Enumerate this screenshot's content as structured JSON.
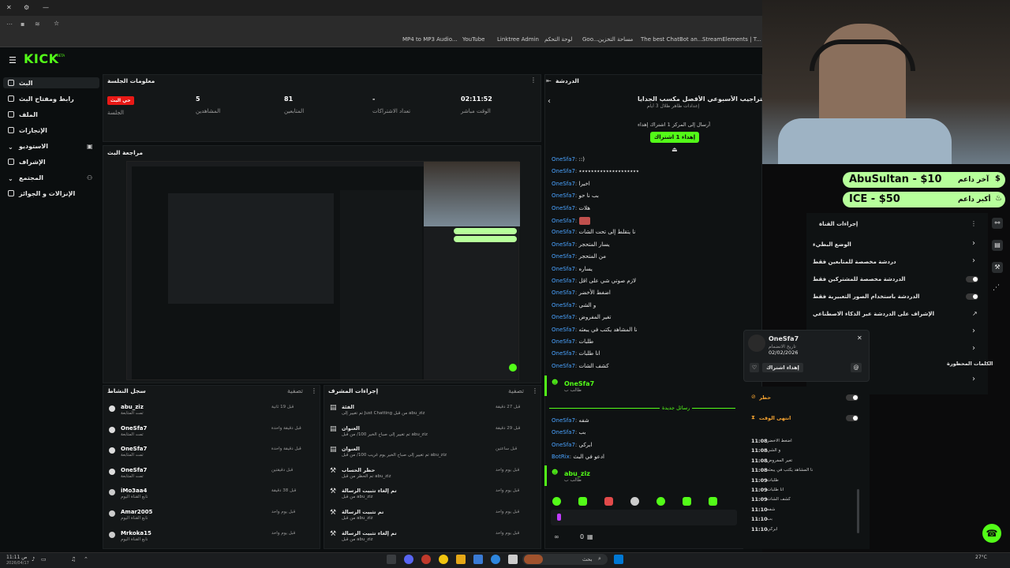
{
  "browser": {
    "bookmarks": [
      "MP4 to MP3 Audio...",
      "YouTube",
      "Linktree Admin",
      "لوحة التحكم",
      "Goo...",
      "مساحة التخزين",
      "The best ChatBot an...",
      "StreamElements | T..."
    ]
  },
  "brand": {
    "logo": "KICK",
    "beta": "BETA"
  },
  "sidebar": {
    "items": [
      {
        "label": "البث"
      },
      {
        "label": "رابط ومفتاح البث"
      },
      {
        "label": "الملف"
      },
      {
        "label": "الإنجازات"
      },
      {
        "label": "الاستوديو"
      },
      {
        "label": "الإشراف"
      },
      {
        "label": "المجتمع"
      },
      {
        "label": "الإنزالات و الجوائز"
      }
    ]
  },
  "session": {
    "title": "معلومات الجلسة",
    "live_badge": "حي البث",
    "session_label": "الجلسة",
    "stats": [
      {
        "value": "5",
        "label": "المشاهدين"
      },
      {
        "value": "81",
        "label": "المتابعين"
      },
      {
        "value": "-",
        "label": "تعداد الاشتراكات"
      },
      {
        "value": "02:11:52",
        "label": "الوقت مباشر"
      }
    ]
  },
  "preview": {
    "title": "مراجعة البث"
  },
  "activity": {
    "title": "سجل النشاط",
    "filter": "تصفية",
    "rows": [
      {
        "user": "abu_ziz",
        "action": "تمت المتابعة",
        "time": "قبل 19 ثانية"
      },
      {
        "user": "OneSfa7",
        "action": "تمت المتابعة",
        "time": "قبل دقيقة واحدة"
      },
      {
        "user": "OneSfa7",
        "action": "تمت المتابعة",
        "time": "قبل دقيقة واحدة"
      },
      {
        "user": "OneSfa7",
        "action": "تمت المتابعة",
        "time": "قبل دقيقتين"
      },
      {
        "user": "iMo3aa4",
        "action": "تابع القناة اليوم",
        "time": "قبل 38 دقيقة"
      },
      {
        "user": "Amar2005",
        "action": "تابع القناة اليوم",
        "time": "قبل يوم واحد"
      },
      {
        "user": "Mrkoka15",
        "action": "تابع القناة اليوم",
        "time": "قبل يوم واحد"
      }
    ]
  },
  "modlog": {
    "title": "إجراءات المشرف",
    "filter": "تصفية",
    "rows": [
      {
        "title": "الفئة",
        "detail": "تم تغيير إلى Just Chatting من قبل abu_ziz",
        "time": "قبل 27 دقيقة"
      },
      {
        "title": "العنوان",
        "detail": "تم تغيير إلى صباح الخير 100/ من قبل abu_ziz",
        "time": "قبل 29 دقيقة"
      },
      {
        "title": "العنوان",
        "detail": "تم تغيير إلى صباح الخير يوم غريب 100/ من قبل abu_ziz",
        "time": "قبل ساعتين"
      },
      {
        "title": "حظر الحساب",
        "detail": "تم الحظر من قبل abu_ziz",
        "time": "قبل يوم واحد"
      },
      {
        "title": "تم إلغاء تثبيت الرسالة",
        "detail": "من قبل abu_ziz",
        "time": "قبل يوم واحد"
      },
      {
        "title": "تم تثبيت الرسالة",
        "detail": "من قبل abu_ziz",
        "time": "قبل يوم واحد"
      },
      {
        "title": "تم إلغاء تثبيت الرسالة",
        "detail": "من قبل abu_ziz",
        "time": "قبل يوم واحد"
      }
    ]
  },
  "chat": {
    "title": "الدردشة",
    "pinned_title": "التراجيب الأسبوعي الأقصل مكسب الجدايا",
    "pinned_sub": "إعدادات ظاهر ظلال 3 أيام",
    "gift_sub": "أرسال إلى المركز 1 اشتراك إهداء",
    "gift_button": "إهداء 1 اشتراك",
    "new_messages": "رسائل جديدة",
    "lines": [
      {
        "user": "OneSfa7",
        "text": "::)"
      },
      {
        "user": "OneSfa7",
        "text": "٭٭٭٭٭٭٭٭٭٭٭٭٭٭٭٭٭٭٭٭"
      },
      {
        "user": "OneSfa7",
        "text": "اخيرا"
      },
      {
        "user": "OneSfa7",
        "text": "بب نا حو"
      },
      {
        "user": "OneSfa7",
        "text": "هلات"
      },
      {
        "user": "OneSfa7",
        "text": ""
      },
      {
        "user": "OneSfa7",
        "text": "نا يتقلط إلى تحت الشات"
      },
      {
        "user": "OneSfa7",
        "text": "يسار المتحجر"
      },
      {
        "user": "OneSfa7",
        "text": "من المتحجر"
      },
      {
        "user": "OneSfa7",
        "text": "يساره"
      },
      {
        "user": "OneSfa7",
        "text": "لازم صوتي شي على اقل"
      },
      {
        "user": "OneSfa7",
        "text": "اضغط الأخضر"
      },
      {
        "user": "OneSfa7",
        "text": "و الشي"
      },
      {
        "user": "OneSfa7",
        "text": "تغير المفروض"
      },
      {
        "user": "OneSfa7",
        "text": "نا المشاهد يكتب في يبعثه"
      },
      {
        "user": "OneSfa7",
        "text": "طلبات"
      },
      {
        "user": "OneSfa7",
        "text": "انا طلبات"
      },
      {
        "user": "OneSfa7",
        "text": "كشف الشات"
      }
    ],
    "highlight_user": "OneSfa7",
    "highlight_sub": "طالب ب",
    "after_lines": [
      {
        "user": "OneSfa7",
        "text": "شفه"
      },
      {
        "user": "OneSfa7",
        "text": "بب"
      },
      {
        "user": "OneSfa7",
        "text": "ابركي"
      },
      {
        "user": "BotRix",
        "text": "ادعو في البث"
      }
    ],
    "second_user": "abu_ziz",
    "second_sub": "طالب ب",
    "footer_count": "0"
  },
  "overlay": {
    "last_supporter_label": "آخر داعم",
    "last_supporter": "AbuSultan - $10",
    "top_supporter_label": "أكبر داعم",
    "top_supporter": "ICE - $50"
  },
  "channel_actions": {
    "title": "إجراءات القناة",
    "items": [
      "الوضع البطيء",
      "دردشة مخصصة للمتابعين فقط",
      "الدردشة مخصصة للمشتركين فقط",
      "الدردشة باستخدام الصور التعبيرية فقط",
      "الإشراف على الدردشة عبر الذكاء الاصطناعي"
    ],
    "blocked_title": "الكلمات المحظورة"
  },
  "user_card": {
    "name": "OneSfa7",
    "joined_label": "تاريخ الانضمام",
    "joined": "02/02/2026",
    "gift_button": "إهداء اشتراك",
    "ban_label": "حظر",
    "timeout_label": "انتهى الوقت",
    "history": [
      {
        "text": "اضغط الأخضر",
        "time": "11:08"
      },
      {
        "text": "و الشي",
        "time": "11:08"
      },
      {
        "text": "تغير المفروض",
        "time": "11:08"
      },
      {
        "text": "نا المشاهد يكتب في يبعثه",
        "time": "11:08"
      },
      {
        "text": "طلبات",
        "time": "11:09"
      },
      {
        "text": "انا طلبات",
        "time": "11:09"
      },
      {
        "text": "كشف الشات",
        "time": "11:09"
      },
      {
        "text": "شفه",
        "time": "11:10"
      },
      {
        "text": "بب",
        "time": "11:10"
      },
      {
        "text": "ابركي",
        "time": "11:10"
      }
    ]
  },
  "taskbar": {
    "search": "بحث",
    "weather": "27°C",
    "clock": "11:11 ص",
    "date": "2026/04/17"
  }
}
